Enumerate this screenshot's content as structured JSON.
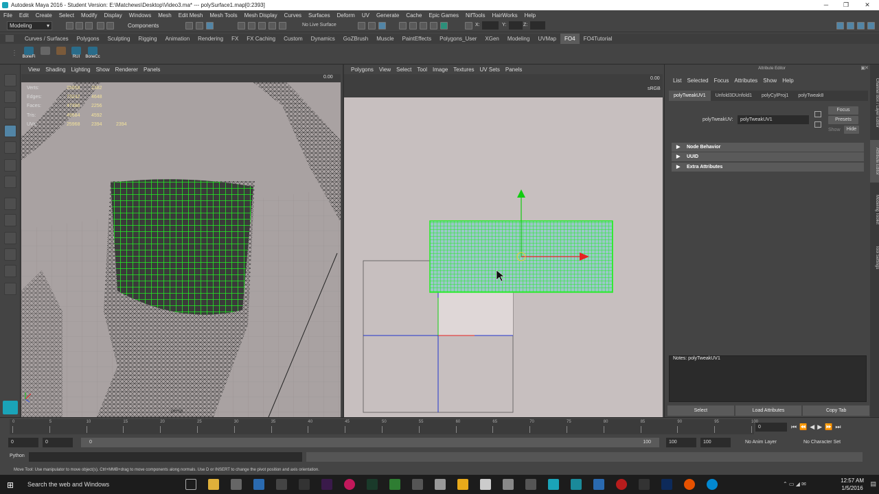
{
  "window": {
    "title": "Autodesk Maya 2016 - Student Version: E:\\Matchews\\Desktop\\Video3.ma*   ---   polySurface1.map[0:2393]"
  },
  "menubar": [
    "File",
    "Edit",
    "Create",
    "Select",
    "Modify",
    "Display",
    "Windows",
    "Mesh",
    "Edit Mesh",
    "Mesh Tools",
    "Mesh Display",
    "Curves",
    "Surfaces",
    "Deform",
    "UV",
    "Generate",
    "Cache",
    "Epic Games",
    "NifTools",
    "HairWorks",
    "Help"
  ],
  "statusline": {
    "mode": "Modeling",
    "components_label": "Components",
    "live_surface": "No Live Surface",
    "x_label": "X:",
    "y_label": "Y:",
    "z_label": "Z:"
  },
  "shelf_tabs": [
    "Curves / Surfaces",
    "Polygons",
    "Sculpting",
    "Rigging",
    "Animation",
    "Rendering",
    "FX",
    "FX Caching",
    "Custom",
    "Dynamics",
    "GoZBrush",
    "Muscle",
    "PaintEffects",
    "Polygons_User",
    "XGen",
    "Modeling",
    "UVMap",
    "FO4",
    "FO4Tutorial"
  ],
  "active_shelf_tab": "FO4",
  "shelf_buttons": [
    "BoneFi",
    "",
    "",
    "RUI",
    "BoneCc"
  ],
  "viewport1": {
    "menu": [
      "View",
      "Shading",
      "Lighting",
      "Show",
      "Renderer",
      "Panels"
    ],
    "hud": [
      {
        "label": "Verts:",
        "v1": "25658",
        "v2": "2382"
      },
      {
        "label": "Edges:",
        "v1": "73242",
        "v2": "4648"
      },
      {
        "label": "Faces:",
        "v1": "47388",
        "v2": "2256"
      },
      {
        "label": "Tris:",
        "v1": "49684",
        "v2": "4592"
      },
      {
        "label": "UVs:",
        "v1": "25968",
        "v2": "2394",
        "v3": "2394"
      }
    ],
    "camera_label": "persp",
    "field_value": "0.00"
  },
  "uv_editor": {
    "menu": [
      "Polygons",
      "View",
      "Select",
      "Tool",
      "Image",
      "Textures",
      "UV Sets",
      "Panels"
    ],
    "field_value": "0.00",
    "srgb_label": "sRGB"
  },
  "attribute_editor": {
    "title": "Attribute Editor",
    "menu": [
      "List",
      "Selected",
      "Focus",
      "Attributes",
      "Show",
      "Help"
    ],
    "tabs": [
      "polyTweakUV1",
      "Unfold3DUnfold1",
      "polyCylProj1",
      "polyTweak8"
    ],
    "node_label": "polyTweakUV:",
    "node_value": "polyTweakUV1",
    "focus_btn": "Focus",
    "presets_btn": "Presets",
    "show_label": "Show",
    "hide_btn": "Hide",
    "sections": [
      "Node Behavior",
      "UUID",
      "Extra Attributes"
    ],
    "notes_label": "Notes:  polyTweakUV1",
    "bottom_buttons": [
      "Select",
      "Load Attributes",
      "Copy Tab"
    ],
    "side_tabs": [
      "Channel Box / Layer Editor",
      "Attribute Editor",
      "Modeling Toolkit",
      "Tool Settings"
    ]
  },
  "timeline": {
    "start_ticks": [
      "0",
      "5",
      "10",
      "15",
      "20",
      "25",
      "30",
      "35",
      "40",
      "45",
      "50",
      "55",
      "60",
      "65",
      "70",
      "75",
      "80",
      "85",
      "90",
      "95",
      "100"
    ],
    "current_frame": "0"
  },
  "range": {
    "start": "0",
    "inner_start": "0",
    "slider_start": "0",
    "slider_end": "100",
    "inner_end": "100",
    "end": "100",
    "anim_layer": "No Anim Layer",
    "char_set": "No Character Set"
  },
  "cmdline": {
    "label": "Python"
  },
  "helpline": "Move Tool: Use manipulator to move object(s). Ctrl+MMB+drag to move components along normals. Use D or INSERT to change the pivot position and axis orientation.",
  "taskbar": {
    "search": "Search the web and Windows",
    "time": "12:57 AM",
    "date": "1/5/2016"
  },
  "colors": {
    "selection_green": "#22ee22",
    "accent_blue": "#5285a6",
    "manip_red": "#e62222",
    "manip_green": "#11cc11"
  }
}
